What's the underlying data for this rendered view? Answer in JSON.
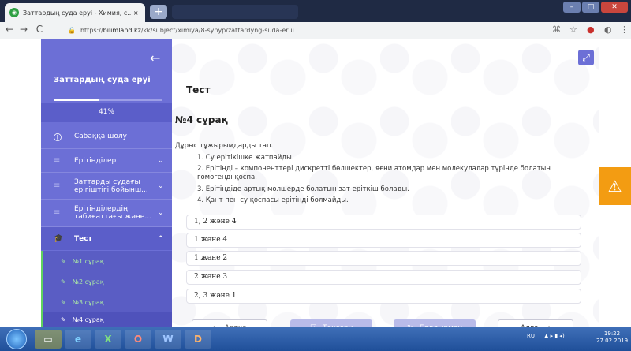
{
  "browser": {
    "tab_title": "Заттардың суда еруі - Химия, с.. ×",
    "tab_close": "×",
    "new_tab": "+",
    "url_prefix": "https://",
    "url_host": "bilimland.kz",
    "url_path": "/kk/subject/ximiya/8-synyp/zattardyng-suda-erui",
    "back": "←",
    "forward": "→",
    "reload": "C"
  },
  "sidebar": {
    "back_icon": "←",
    "title": "Заттардың суда еруі",
    "progress_text": "41%",
    "progress_value": 0.41,
    "items": [
      {
        "icon": "i",
        "label": "Сабаққа шолу",
        "chevron": ""
      },
      {
        "icon": "≡",
        "label": "Ерітінділер",
        "chevron": "⌄"
      },
      {
        "icon": "≡",
        "label": "Заттарды судағы ерігіштігі бойынш...",
        "chevron": "⌄"
      },
      {
        "icon": "≡",
        "label": "Ерітінділердің табиғаттағы жәнe...",
        "chevron": "⌄"
      },
      {
        "icon": "≡",
        "label": "Тест",
        "chevron": "⌃"
      }
    ],
    "subitems": [
      {
        "label": "№1 сұрақ"
      },
      {
        "label": "№2 сұрақ"
      },
      {
        "label": "№3 сұрақ"
      },
      {
        "label": "№4 сұрақ"
      }
    ]
  },
  "main": {
    "title": "Тест",
    "question_title": "№4 сұрақ",
    "prompt": "Дұрыс тұжырымдарды тап.",
    "statements": [
      "1. Су ерітікішке жатпайды.",
      "2. Ерітінді – компоненттері дискретті бөлшектер, яғни атомдар мен молекулалар түрінде болатын гомогенді қоспа.",
      "3. Ерітіндіде артық мөлшерде болатын зат еріткіш болады.",
      "4. Қант пен су қоспасы ерітінді болмайды."
    ],
    "options": [
      "1, 2 және 4",
      "1 және 4",
      "1 және 2",
      "2 және 3",
      "2, 3 және 1"
    ],
    "buttons": {
      "back": "Артқа",
      "check": "Тексеру",
      "reset": "Болдырмау",
      "next": "Алға"
    }
  },
  "taskbar": {
    "apps": [
      "e",
      "X",
      "O",
      "W",
      "D"
    ],
    "tray": "RU",
    "time": "19:22",
    "date": "27.02.2019"
  },
  "colors": {
    "sidebar": "#6c6fd6",
    "accent_green": "#5fd35f",
    "warning": "#f39c12"
  }
}
